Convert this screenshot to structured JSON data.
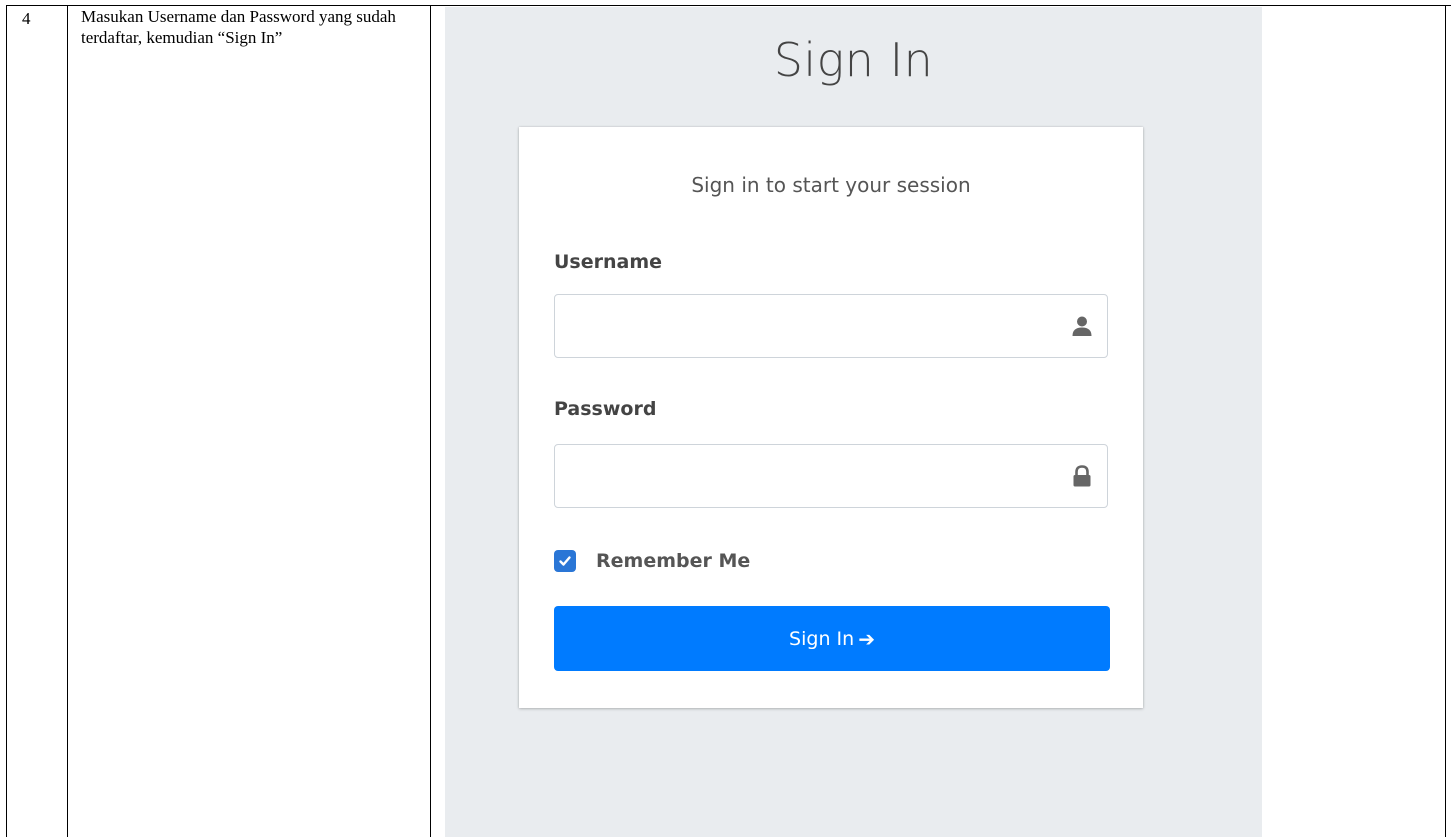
{
  "document": {
    "step_number": "4",
    "step_text": "Masukan Username dan Password yang sudah terdaftar, kemudian “Sign In”"
  },
  "login": {
    "title": "Sign In",
    "subtitle": "Sign in to start your session",
    "username_label": "Username",
    "username_value": "",
    "password_label": "Password",
    "password_value": "",
    "remember_label": "Remember Me",
    "remember_checked": true,
    "submit_label": "Sign In",
    "submit_icon": "arrow-right-icon",
    "username_icon": "user-icon",
    "password_icon": "lock-icon"
  },
  "colors": {
    "background": "#e9ecef",
    "primary": "#007bff",
    "checkbox": "#2a76d6"
  }
}
